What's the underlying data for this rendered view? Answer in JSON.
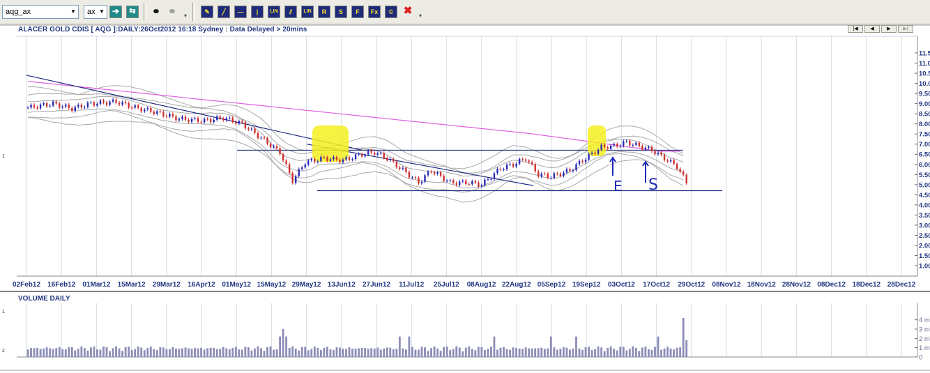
{
  "toolbar": {
    "symbol_value": "aqg_ax",
    "exchange_value": "ax",
    "icons": [
      "go-icon",
      "refresh-icon",
      "binoculars-icon",
      "binoculars-disabled-icon",
      "pen-icon",
      "line-icon",
      "hline-icon",
      "vline-icon",
      "lin-icon",
      "parallel-icon",
      "lin-channel-icon",
      "r-icon",
      "s-icon",
      "fib-f-icon",
      "fib-fx-icon",
      "text-c-icon",
      "delete-icon"
    ]
  },
  "chart": {
    "title": "ALACER GOLD CDIS [ AQG ]:DAILY:26Oct2012 16:18 Sydney : Data Delayed > 20mins",
    "y_ticks": [
      "11.5",
      "11.0",
      "10.5",
      "10.0",
      "9.50",
      "9.00",
      "8.50",
      "8.00",
      "7.50",
      "7.00",
      "6.50",
      "6.00",
      "5.50",
      "5.00",
      "4.50",
      "4.00",
      "3.50",
      "3.00",
      "2.50",
      "2.00",
      "1.50",
      "1.00"
    ],
    "x_ticks": [
      "02Feb12",
      "16Feb12",
      "01Mar12",
      "15Mar12",
      "29Mar12",
      "16Apr12",
      "01May12",
      "15May12",
      "29May12",
      "13Jun12",
      "27Jun12",
      "11Jul12",
      "25Jul12",
      "08Aug12",
      "22Aug12",
      "05Sep12",
      "19Sep12",
      "03Oct12",
      "17Oct12",
      "29Oct12",
      "08Nov12",
      "18Nov12",
      "28Nov12",
      "08Dec12",
      "18Dec12",
      "28Dec12"
    ],
    "left_marker": "1",
    "annotation_e": "E",
    "annotation_s": "S",
    "colors": {
      "up": "#2a2ab8",
      "down": "#d03030",
      "ma": "#e060e0",
      "trend": "#1f2a80",
      "highlight": "#f4f020"
    }
  },
  "volume": {
    "title": "VOLUME DAILY",
    "y_ticks": [
      "4 m",
      "3 m",
      "2 m",
      "1 m",
      "0"
    ],
    "left_marker_top": "1",
    "left_marker_bottom": "2"
  },
  "nav": {
    "first": "|◀",
    "prev": "◀",
    "next": "▶",
    "last": "▶|"
  }
}
